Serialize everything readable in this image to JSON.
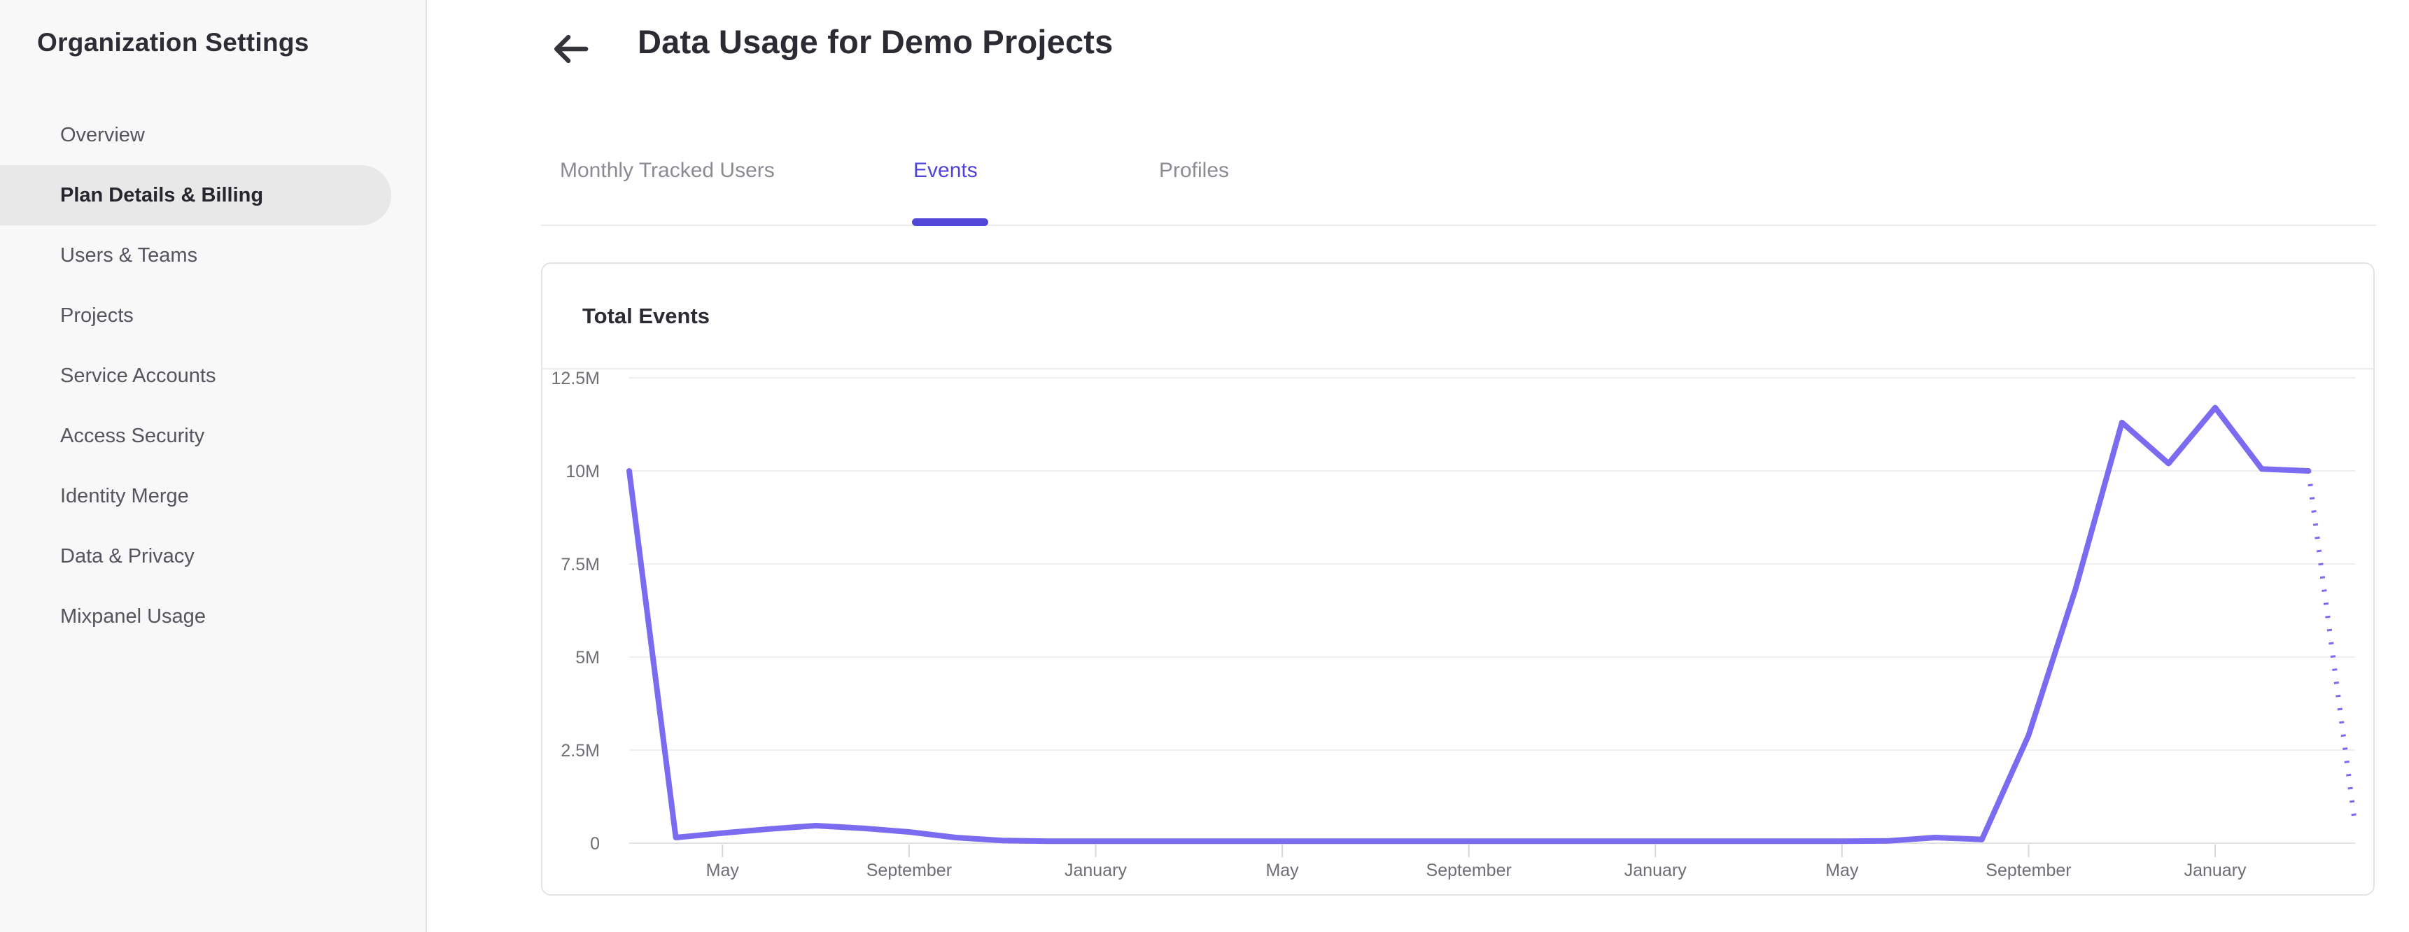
{
  "sidebar": {
    "title": "Organization Settings",
    "items": [
      {
        "label": "Overview",
        "selected": false
      },
      {
        "label": "Plan Details & Billing",
        "selected": true
      },
      {
        "label": "Users & Teams",
        "selected": false
      },
      {
        "label": "Projects",
        "selected": false
      },
      {
        "label": "Service Accounts",
        "selected": false
      },
      {
        "label": "Access Security",
        "selected": false
      },
      {
        "label": "Identity Merge",
        "selected": false
      },
      {
        "label": "Data & Privacy",
        "selected": false
      },
      {
        "label": "Mixpanel Usage",
        "selected": false
      }
    ]
  },
  "header": {
    "title": "Data Usage for Demo Projects",
    "back_icon": "arrow-left-icon"
  },
  "tabs": [
    {
      "label": "Monthly Tracked Users",
      "active": false
    },
    {
      "label": "Events",
      "active": true
    },
    {
      "label": "Profiles",
      "active": false
    }
  ],
  "card": {
    "title": "Total Events"
  },
  "colors": {
    "accent_purple": "#5246d9",
    "chart_line": "#7a6bf0",
    "sidebar_bg": "#f8f8f8",
    "selected_item_bg": "#e8e8e8",
    "text_dark": "#2b2b33",
    "sidebar_text": "#55555e",
    "tab_inactive_text": "#8b8b92",
    "axis_label_text": "#6e6e74",
    "card_border": "#e4e4e6",
    "gridline": "#efeff1"
  },
  "chart_data": {
    "type": "line",
    "title": "Total Events",
    "granularity": "monthly",
    "ylim_millions": [
      0,
      12.5
    ],
    "y_tick_labels": [
      "12.5M",
      "10M",
      "7.5M",
      "5M",
      "2.5M",
      "0"
    ],
    "y_tick_values_millions": [
      12.5,
      10,
      7.5,
      5,
      2.5,
      0
    ],
    "x_tick_labels": [
      "May",
      "September",
      "January",
      "May",
      "September",
      "January",
      "May",
      "September",
      "January"
    ],
    "x_tick_indices": [
      2,
      6,
      10,
      14,
      18,
      22,
      26,
      30,
      34
    ],
    "grid": "horizontal",
    "legend": "none",
    "line_color": "#7a6bf0",
    "solid_until_index": 36,
    "line_style_note": "final segment rendered dotted (incomplete month projection)",
    "series": [
      {
        "name": "Total Events",
        "unit": "millions of events",
        "values_millions": [
          10,
          0.15,
          0.27,
          0.38,
          0.47,
          0.4,
          0.3,
          0.15,
          0.07,
          0.05,
          0.05,
          0.05,
          0.05,
          0.05,
          0.05,
          0.05,
          0.05,
          0.05,
          0.05,
          0.05,
          0.05,
          0.05,
          0.05,
          0.05,
          0.05,
          0.05,
          0.05,
          0.06,
          0.15,
          0.1,
          2.9,
          6.8,
          11.3,
          10.2,
          11.7,
          10.05,
          10,
          0.5
        ]
      }
    ]
  }
}
